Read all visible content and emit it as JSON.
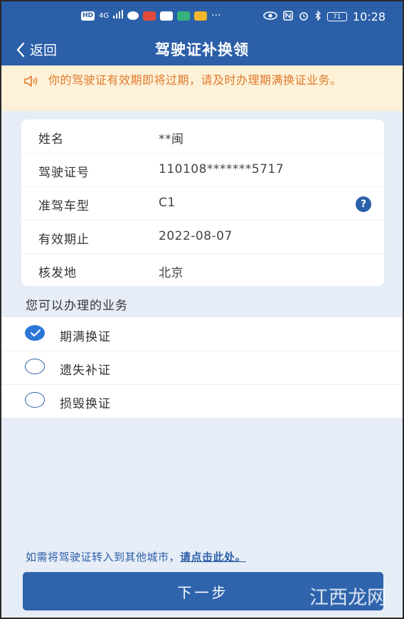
{
  "status_bar": {
    "hd": "HD",
    "signal": "4G",
    "more": "···",
    "battery": "71",
    "time": "10:28"
  },
  "nav": {
    "back_label": "返回",
    "title": "驾驶证补换领"
  },
  "notice": {
    "text": "你的驾驶证有效期即将过期，请及时办理期满换证业务。"
  },
  "license": {
    "rows": [
      {
        "label": "姓名",
        "value": "**闽"
      },
      {
        "label": "驾驶证号",
        "value": "110108*******5717"
      },
      {
        "label": "准驾车型",
        "value": "C1"
      },
      {
        "label": "有效期止",
        "value": "2022-08-07"
      },
      {
        "label": "核发地",
        "value": "北京"
      }
    ],
    "help_icon": "?"
  },
  "services": {
    "title": "您可以办理的业务",
    "options": [
      {
        "label": "期满换证",
        "checked": true
      },
      {
        "label": "遗失补证",
        "checked": false
      },
      {
        "label": "损毁换证",
        "checked": false
      }
    ]
  },
  "footer": {
    "note": "如需将驾驶证转入到其他城市，",
    "link": "请点击此处。",
    "next_button": "下一步"
  },
  "watermark": {
    "brand": "江西龙网"
  }
}
